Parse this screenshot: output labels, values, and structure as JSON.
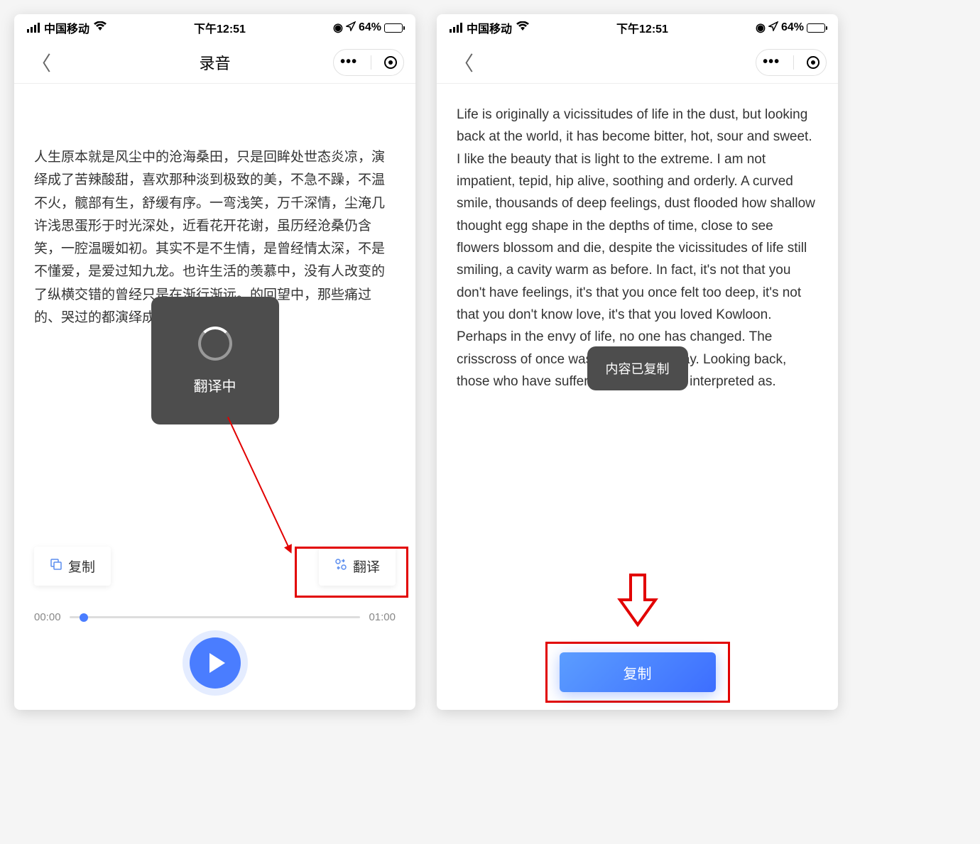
{
  "status": {
    "carrier": "中国移动",
    "time": "下午12:51",
    "battery_pct": "64%"
  },
  "phone1": {
    "nav_title": "录音",
    "body_text": "人生原本就是风尘中的沧海桑田，只是回眸处世态炎凉，演绎成了苦辣酸甜，喜欢那种淡到极致的美，不急不躁，不温不火，髋部有生，舒缓有序。一弯浅笑，万千深情，尘淹几许浅思蛋形于时光深处，近看花开花谢，虽历经沧桑仍含笑，一腔温暖如初。其实不是不生情，是曾经情太深，不是不懂爱，是爱过知九龙。也许生活的羡慕中，没有人改变的了纵横交错的曾经只是在渐行渐远。的回望中，那些痛过的、哭过的都演绎成。",
    "toast_text": "翻译中",
    "copy_button": "复制",
    "translate_button": "翻译",
    "time_start": "00:00",
    "time_end": "01:00"
  },
  "phone2": {
    "body_text": "Life is originally a vicissitudes of life in the dust, but looking back at the world, it has become bitter, hot, sour and sweet. I like the beauty that is light to the extreme. I am not impatient, tepid, hip alive, soothing and orderly. A curved smile, thousands of deep feelings, dust flooded how shallow thought egg shape in the depths of time, close to see flowers blossom and die, despite the vicissitudes of life still smiling, a cavity warm as before. In fact, it's not that you don't have feelings, it's that you once felt too deep, it's not that you don't know love, it's that you loved Kowloon. Perhaps in the envy of life, no one has changed. The crisscross of once was just drifting away. Looking back, those who have suffered and cried are interpreted as.",
    "toast_text": "内容已复制",
    "copy_button": "复制"
  }
}
